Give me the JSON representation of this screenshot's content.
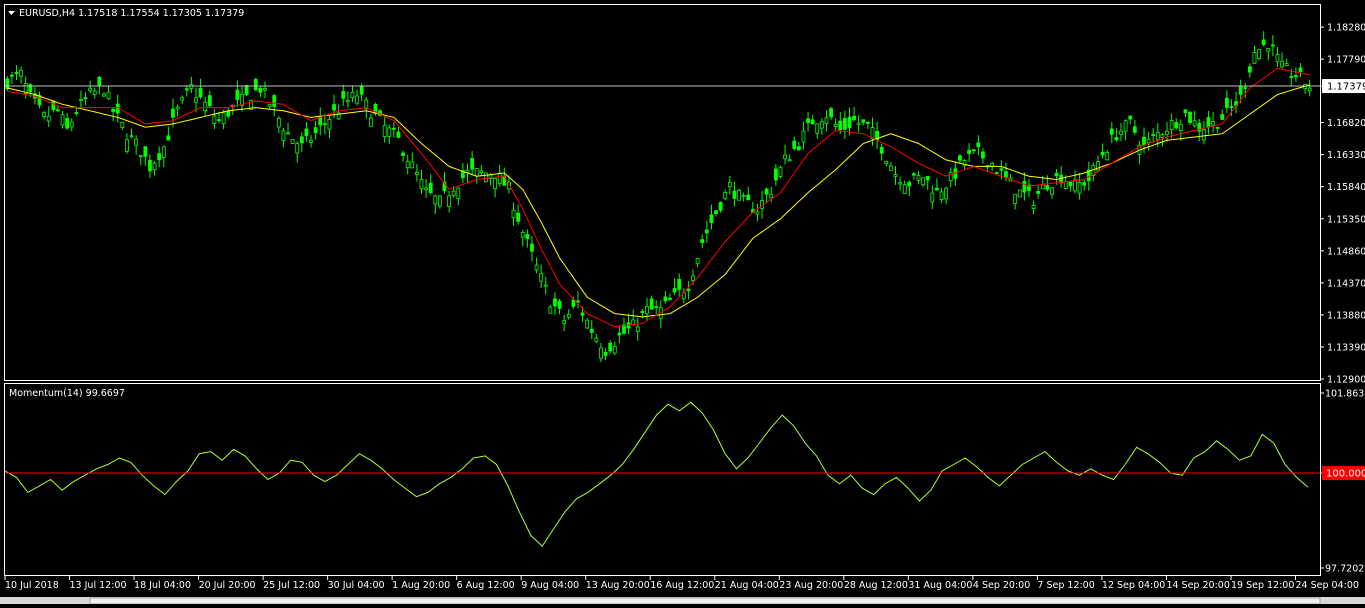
{
  "chart_data": [
    {
      "type": "candlestick",
      "symbol_header": "EURUSD,H4  1.17518 1.17554 1.17305 1.17379",
      "current_price_label": "1.17379",
      "current_price": 1.17379,
      "ylim": [
        1.129,
        1.1845
      ],
      "y_ticks": [
        "1.18280",
        "1.17790",
        "1.17379",
        "1.16820",
        "1.16330",
        "1.15840",
        "1.15350",
        "1.14860",
        "1.14370",
        "1.13880",
        "1.13390",
        "1.12900"
      ],
      "x_ticks": [
        "10 Jul 2018",
        "13 Jul 12:00",
        "18 Jul 04:00",
        "20 Jul 20:00",
        "25 Jul 12:00",
        "30 Jul 04:00",
        "1 Aug 20:00",
        "6 Aug 12:00",
        "9 Aug 04:00",
        "13 Aug 20:00",
        "16 Aug 12:00",
        "21 Aug 04:00",
        "23 Aug 20:00",
        "28 Aug 12:00",
        "31 Aug 04:00",
        "4 Sep 20:00",
        "7 Sep 12:00",
        "12 Sep 04:00",
        "14 Sep 20:00",
        "19 Sep 12:00",
        "24 Sep 04:00"
      ],
      "price_path": [
        [
          0,
          1.1745
        ],
        [
          3,
          1.1755
        ],
        [
          5,
          1.172
        ],
        [
          8,
          1.169
        ],
        [
          11,
          1.17
        ],
        [
          13,
          1.167
        ],
        [
          15,
          1.17
        ],
        [
          18,
          1.1725
        ],
        [
          21,
          1.1735
        ],
        [
          23,
          1.17
        ],
        [
          26,
          1.1665
        ],
        [
          29,
          1.164
        ],
        [
          31,
          1.1615
        ],
        [
          34,
          1.1645
        ],
        [
          37,
          1.17
        ],
        [
          40,
          1.1735
        ],
        [
          43,
          1.171
        ],
        [
          46,
          1.1685
        ],
        [
          49,
          1.1705
        ],
        [
          52,
          1.172
        ],
        [
          55,
          1.1735
        ],
        [
          58,
          1.17
        ],
        [
          61,
          1.1665
        ],
        [
          64,
          1.1645
        ],
        [
          67,
          1.1665
        ],
        [
          70,
          1.169
        ],
        [
          73,
          1.171
        ],
        [
          76,
          1.1725
        ],
        [
          79,
          1.17
        ],
        [
          82,
          1.1675
        ],
        [
          85,
          1.1655
        ],
        [
          88,
          1.1615
        ],
        [
          91,
          1.1575
        ],
        [
          94,
          1.156
        ],
        [
          97,
          1.1585
        ],
        [
          100,
          1.1605
        ],
        [
          103,
          1.1605
        ],
        [
          106,
          1.1605
        ],
        [
          109,
          1.158
        ],
        [
          112,
          1.1515
        ],
        [
          115,
          1.146
        ],
        [
          118,
          1.141
        ],
        [
          121,
          1.138
        ],
        [
          124,
          1.1405
        ],
        [
          127,
          1.1365
        ],
        [
          130,
          1.1335
        ],
        [
          133,
          1.1355
        ],
        [
          136,
          1.137
        ],
        [
          139,
          1.1395
        ],
        [
          142,
          1.1395
        ],
        [
          145,
          1.1415
        ],
        [
          148,
          1.1435
        ],
        [
          151,
          1.15
        ],
        [
          154,
          1.1545
        ],
        [
          157,
          1.1585
        ],
        [
          160,
          1.156
        ],
        [
          163,
          1.155
        ],
        [
          166,
          1.158
        ],
        [
          169,
          1.1625
        ],
        [
          172,
          1.165
        ],
        [
          175,
          1.1685
        ],
        [
          178,
          1.1695
        ],
        [
          181,
          1.167
        ],
        [
          184,
          1.1685
        ],
        [
          187,
          1.1675
        ],
        [
          190,
          1.1645
        ],
        [
          193,
          1.1605
        ],
        [
          196,
          1.159
        ],
        [
          199,
          1.16
        ],
        [
          202,
          1.1575
        ],
        [
          205,
          1.1595
        ],
        [
          208,
          1.1625
        ],
        [
          211,
          1.1635
        ],
        [
          214,
          1.162
        ],
        [
          217,
          1.1595
        ],
        [
          220,
          1.1575
        ],
        [
          223,
          1.1565
        ],
        [
          226,
          1.159
        ],
        [
          229,
          1.16
        ],
        [
          232,
          1.1585
        ],
        [
          235,
          1.1595
        ],
        [
          238,
          1.1635
        ],
        [
          241,
          1.1665
        ],
        [
          244,
          1.168
        ],
        [
          247,
          1.1645
        ],
        [
          250,
          1.1665
        ],
        [
          253,
          1.168
        ],
        [
          256,
          1.1695
        ],
        [
          259,
          1.1675
        ],
        [
          262,
          1.168
        ],
        [
          265,
          1.1695
        ],
        [
          268,
          1.172
        ],
        [
          271,
          1.179
        ],
        [
          274,
          1.1805
        ],
        [
          277,
          1.1765
        ],
        [
          280,
          1.1755
        ],
        [
          283,
          1.1738
        ]
      ],
      "ma_fast_path": [
        [
          0,
          1.173
        ],
        [
          6,
          1.1722
        ],
        [
          12,
          1.1705
        ],
        [
          18,
          1.1705
        ],
        [
          24,
          1.1705
        ],
        [
          30,
          1.168
        ],
        [
          36,
          1.1685
        ],
        [
          42,
          1.1705
        ],
        [
          48,
          1.1705
        ],
        [
          54,
          1.1715
        ],
        [
          60,
          1.171
        ],
        [
          66,
          1.1685
        ],
        [
          72,
          1.17
        ],
        [
          78,
          1.1705
        ],
        [
          84,
          1.1685
        ],
        [
          90,
          1.1635
        ],
        [
          96,
          1.158
        ],
        [
          102,
          1.1595
        ],
        [
          108,
          1.16
        ],
        [
          112,
          1.155
        ],
        [
          116,
          1.149
        ],
        [
          120,
          1.1435
        ],
        [
          126,
          1.139
        ],
        [
          132,
          1.137
        ],
        [
          138,
          1.1375
        ],
        [
          144,
          1.14
        ],
        [
          150,
          1.1445
        ],
        [
          156,
          1.15
        ],
        [
          162,
          1.1545
        ],
        [
          168,
          1.1575
        ],
        [
          174,
          1.1635
        ],
        [
          180,
          1.167
        ],
        [
          186,
          1.1665
        ],
        [
          192,
          1.1645
        ],
        [
          198,
          1.162
        ],
        [
          204,
          1.16
        ],
        [
          210,
          1.1615
        ],
        [
          216,
          1.16
        ],
        [
          222,
          1.1585
        ],
        [
          228,
          1.159
        ],
        [
          234,
          1.1595
        ],
        [
          240,
          1.162
        ],
        [
          246,
          1.1645
        ],
        [
          252,
          1.166
        ],
        [
          258,
          1.167
        ],
        [
          264,
          1.168
        ],
        [
          270,
          1.1735
        ],
        [
          276,
          1.1765
        ],
        [
          283,
          1.1755
        ]
      ],
      "ma_slow_path": [
        [
          0,
          1.1735
        ],
        [
          6,
          1.1725
        ],
        [
          12,
          1.171
        ],
        [
          18,
          1.17
        ],
        [
          24,
          1.169
        ],
        [
          30,
          1.1675
        ],
        [
          36,
          1.168
        ],
        [
          42,
          1.169
        ],
        [
          48,
          1.17
        ],
        [
          54,
          1.1705
        ],
        [
          60,
          1.17
        ],
        [
          66,
          1.169
        ],
        [
          72,
          1.1695
        ],
        [
          78,
          1.17
        ],
        [
          84,
          1.169
        ],
        [
          90,
          1.165
        ],
        [
          96,
          1.1615
        ],
        [
          102,
          1.16
        ],
        [
          108,
          1.1605
        ],
        [
          112,
          1.158
        ],
        [
          116,
          1.153
        ],
        [
          120,
          1.1475
        ],
        [
          126,
          1.1415
        ],
        [
          132,
          1.139
        ],
        [
          138,
          1.1385
        ],
        [
          144,
          1.139
        ],
        [
          150,
          1.1415
        ],
        [
          156,
          1.145
        ],
        [
          162,
          1.1505
        ],
        [
          168,
          1.1535
        ],
        [
          174,
          1.1575
        ],
        [
          180,
          1.161
        ],
        [
          186,
          1.165
        ],
        [
          192,
          1.1665
        ],
        [
          198,
          1.165
        ],
        [
          204,
          1.1625
        ],
        [
          210,
          1.1615
        ],
        [
          216,
          1.1615
        ],
        [
          222,
          1.16
        ],
        [
          228,
          1.1595
        ],
        [
          234,
          1.1605
        ],
        [
          240,
          1.162
        ],
        [
          246,
          1.164
        ],
        [
          252,
          1.1655
        ],
        [
          258,
          1.166
        ],
        [
          264,
          1.1665
        ],
        [
          270,
          1.1695
        ],
        [
          276,
          1.1725
        ],
        [
          283,
          1.174
        ]
      ]
    },
    {
      "type": "line",
      "indicator_header": "Momentum(14) 99.6697",
      "current_value_label": "100.0000",
      "reference_level": 100.0,
      "ylim": [
        97.7202,
        101.8635
      ],
      "y_ticks": [
        "101.8635",
        "100.0000",
        "97.7202"
      ],
      "values": [
        100.05,
        99.9,
        99.55,
        99.7,
        99.85,
        99.6,
        99.8,
        99.95,
        100.1,
        100.2,
        100.35,
        100.25,
        99.95,
        99.7,
        99.5,
        99.8,
        100.05,
        100.45,
        100.5,
        100.3,
        100.55,
        100.4,
        100.1,
        99.85,
        100.0,
        100.3,
        100.25,
        99.95,
        99.8,
        99.95,
        100.2,
        100.45,
        100.3,
        100.1,
        99.85,
        99.65,
        99.45,
        99.55,
        99.75,
        99.9,
        100.1,
        100.35,
        100.4,
        100.2,
        99.7,
        99.1,
        98.55,
        98.3,
        98.7,
        99.1,
        99.4,
        99.55,
        99.75,
        99.95,
        100.2,
        100.55,
        100.95,
        101.35,
        101.6,
        101.45,
        101.65,
        101.4,
        101.0,
        100.45,
        100.1,
        100.35,
        100.7,
        101.05,
        101.35,
        101.1,
        100.7,
        100.4,
        99.95,
        99.75,
        99.95,
        99.65,
        99.5,
        99.75,
        99.9,
        99.65,
        99.35,
        99.6,
        100.05,
        100.2,
        100.35,
        100.15,
        99.9,
        99.7,
        99.95,
        100.2,
        100.35,
        100.5,
        100.25,
        100.05,
        99.95,
        100.1,
        99.95,
        99.85,
        100.2,
        100.6,
        100.45,
        100.25,
        100.0,
        99.95,
        100.35,
        100.5,
        100.75,
        100.55,
        100.3,
        100.4,
        100.9,
        100.7,
        100.2,
        99.9,
        99.67
      ]
    }
  ]
}
